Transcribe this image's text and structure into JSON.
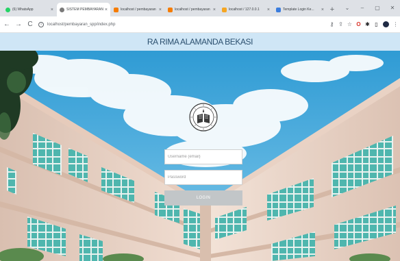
{
  "browser": {
    "tabs": [
      {
        "title": "(6) WhatsApp",
        "favicon_color": "#25d366",
        "active": false
      },
      {
        "title": "SISTEM PEMBAYARAN",
        "favicon_color": "#7a7a7a",
        "active": true
      },
      {
        "title": "localhost / pembayaran",
        "favicon_color": "#f57c00",
        "active": false
      },
      {
        "title": "localhost / pembayaran",
        "favicon_color": "#f57c00",
        "active": false
      },
      {
        "title": "localhost / 127.0.0.1",
        "favicon_color": "#f5a623",
        "active": false
      },
      {
        "title": "Template Login Ke...",
        "favicon_color": "#3b7ddd",
        "active": false
      }
    ],
    "new_tab_label": "+",
    "url": "localhost/pembayaran_spp/index.php"
  },
  "page": {
    "title": "RA RIMA ALAMANDA BEKASI",
    "colors": {
      "banner_bg": "#cfe6f6",
      "banner_text": "#2b4f6e",
      "sky": "#3aa3d8",
      "building_wall": "#efd9cc",
      "window_glass": "#4fb6ae"
    }
  },
  "login": {
    "username_placeholder": "Username (email)",
    "password_placeholder": "Password",
    "submit_label": "LOGIN"
  },
  "icons": {
    "logo": "school-seal-icon"
  }
}
